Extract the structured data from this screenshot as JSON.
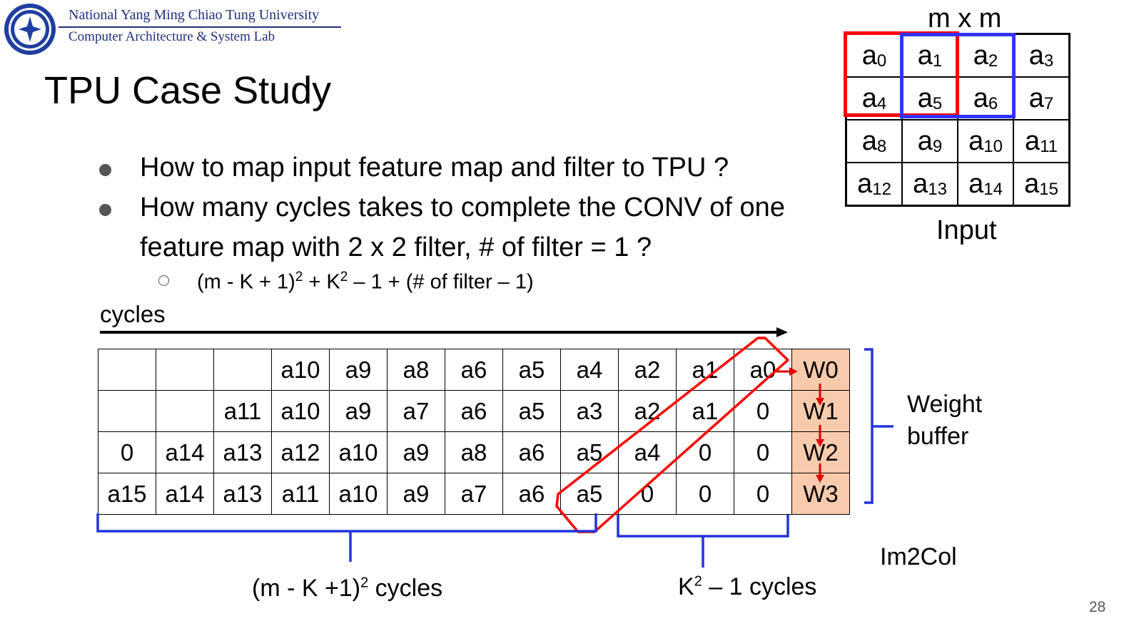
{
  "header": {
    "university": "National Yang Ming Chiao Tung University",
    "lab": "Computer Architecture & System Lab",
    "logo_icon": "nycu-seal-icon"
  },
  "title": "TPU Case Study",
  "bullets": [
    {
      "lines": [
        "How to map input feature map and filter to TPU ?"
      ]
    },
    {
      "lines": [
        "How many cycles takes to complete the CONV of one",
        "feature map with 2 x 2 filter, # of filter = 1 ?"
      ]
    }
  ],
  "sub_bullet": {
    "part1": "(m - K + 1)",
    "sup1": "2",
    "part2": " + K",
    "sup2": "2",
    "part3": " – 1 + (# of filter – 1)"
  },
  "input_matrix": {
    "size_label": "m x m",
    "caption": "Input",
    "cells": [
      [
        "0",
        "1",
        "2",
        "3"
      ],
      [
        "4",
        "5",
        "6",
        "7"
      ],
      [
        "8",
        "9",
        "10",
        "11"
      ],
      [
        "12",
        "13",
        "14",
        "15"
      ]
    ],
    "highlight_colors": {
      "red": "#ff0000",
      "blue": "#3333ff"
    }
  },
  "cycles_label": "cycles",
  "im2col_table": {
    "rows": [
      [
        "",
        "",
        "",
        "a10",
        "a9",
        "a8",
        "a6",
        "a5",
        "a4",
        "a2",
        "a1",
        "a0",
        "W0"
      ],
      [
        "",
        "",
        "a11",
        "a10",
        "a9",
        "a7",
        "a6",
        "a5",
        "a3",
        "a2",
        "a1",
        "0",
        "W1"
      ],
      [
        "0",
        "a14",
        "a13",
        "a12",
        "a10",
        "a9",
        "a8",
        "a6",
        "a5",
        "a4",
        "0",
        "0",
        "W2"
      ],
      [
        "a15",
        "a14",
        "a13",
        "a11",
        "a10",
        "a9",
        "a7",
        "a6",
        "a5",
        "0",
        "0",
        "0",
        "W3"
      ]
    ],
    "weight_fill_color": "#f8cbad"
  },
  "weight_buffer_label": [
    "Weight",
    "buffer"
  ],
  "im2col_label": "Im2Col",
  "left_brace_label": {
    "text1": "(m - K +1)",
    "sup": "2",
    "text2": " cycles"
  },
  "right_brace_label": {
    "text1": "K",
    "sup": "2",
    "text2": " – 1 cycles"
  },
  "page_number": "28"
}
